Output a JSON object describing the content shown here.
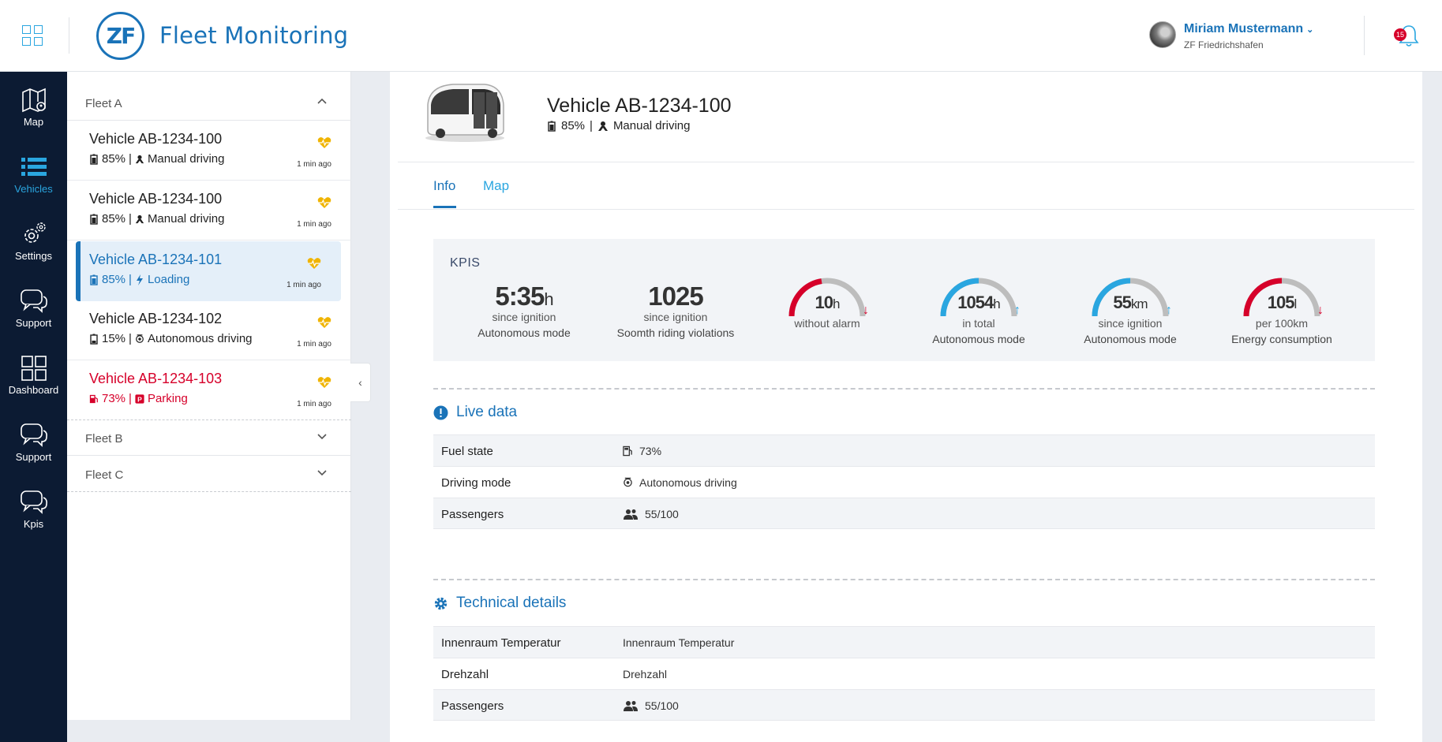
{
  "header": {
    "app_title": "Fleet Monitoring",
    "logo_text": "ZF",
    "user_name": "Miriam Mustermann",
    "user_org": "ZF Friedrichshafen",
    "notification_count": "15"
  },
  "nav": [
    {
      "label": "Map",
      "icon": "map-icon"
    },
    {
      "label": "Vehicles",
      "icon": "list-icon",
      "active": true
    },
    {
      "label": "Settings",
      "icon": "gear-icon"
    },
    {
      "label": "Support",
      "icon": "chat-icon"
    },
    {
      "label": "Dashboard",
      "icon": "dashboard-icon"
    },
    {
      "label": "Support",
      "icon": "chat-icon"
    },
    {
      "label": "Kpis",
      "icon": "chat-icon"
    }
  ],
  "fleets": {
    "a": "Fleet A",
    "b": "Fleet B",
    "c": "Fleet C"
  },
  "vehicles": [
    {
      "name": "Vehicle AB-1234-100",
      "battery": "85%",
      "mode": "Manual driving",
      "ago": "1 min ago"
    },
    {
      "name": "Vehicle AB-1234-100",
      "battery": "85%",
      "mode": "Manual driving",
      "ago": "1 min ago"
    },
    {
      "name": "Vehicle AB-1234-101",
      "battery": "85%",
      "mode": "Loading",
      "ago": "1 min ago"
    },
    {
      "name": "Vehicle AB-1234-102",
      "battery": "15%",
      "mode": "Autonomous driving",
      "ago": "1 min ago"
    },
    {
      "name": "Vehicle AB-1234-103",
      "battery": "73%",
      "mode": "Parking",
      "ago": "1 min ago"
    }
  ],
  "detail": {
    "title": "Vehicle AB-1234-100",
    "battery": "85%",
    "separator": "|",
    "mode": "Manual driving",
    "tabs": [
      "Info",
      "Map"
    ]
  },
  "kpis": {
    "title": "KPIS",
    "items": [
      {
        "value": "5:35",
        "unit": "h",
        "line1": "since ignition",
        "line2": "Autonomous mode"
      },
      {
        "value": "1025",
        "unit": "",
        "line1": "since ignition",
        "line2": "Soomth riding violations"
      },
      {
        "value": "10",
        "unit": "h",
        "line1": "without alarm",
        "line2": "",
        "fill": 0.45,
        "color": "#d6002a",
        "trend": "down"
      },
      {
        "value": "1054",
        "unit": "h",
        "line1": "in total",
        "line2": "Autonomous mode",
        "fill": 0.5,
        "color": "#2aa6e0",
        "trend": "up"
      },
      {
        "value": "55",
        "unit": "km",
        "line1": "since ignition",
        "line2": "Autonomous mode",
        "fill": 0.5,
        "color": "#2aa6e0",
        "trend": "up"
      },
      {
        "value": "105",
        "unit": "l",
        "line1": "per 100km",
        "line2": "Energy consumption",
        "fill": 0.5,
        "color": "#d6002a",
        "trend": "down"
      }
    ]
  },
  "live": {
    "title": "Live data",
    "rows": [
      {
        "key": "Fuel state",
        "value": "73%",
        "icon": "fuel-icon"
      },
      {
        "key": "Driving mode",
        "value": "Autonomous driving",
        "icon": "autonomous-icon"
      },
      {
        "key": "Passengers",
        "value": "55/100",
        "icon": "people-icon"
      }
    ]
  },
  "tech": {
    "title": "Technical details",
    "rows": [
      {
        "key": "Innenraum Temperatur",
        "value": "Innenraum Temperatur"
      },
      {
        "key": "Drehzahl",
        "value": "Drehzahl"
      },
      {
        "key": "Passengers",
        "value": "55/100",
        "icon": "people-icon"
      }
    ]
  },
  "colors": {
    "accent": "#1a73b8",
    "accent_light": "#2aa6e0",
    "alert": "#d6002a",
    "heart": "#f0b400",
    "nav_bg": "#0c1b33"
  }
}
